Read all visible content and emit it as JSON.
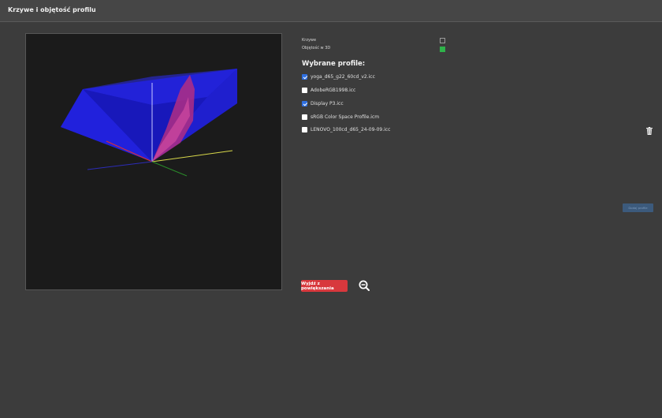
{
  "window": {
    "title": "Krzywe i objętość profilu"
  },
  "options": [
    {
      "label": "Krzywe",
      "checked": false
    },
    {
      "label": "Objętość w 3D",
      "checked": true
    }
  ],
  "profiles": {
    "heading": "Wybrane profile:",
    "items": [
      {
        "label": "yoga_d65_g22_60cd_v2.icc",
        "checked": true
      },
      {
        "label": "AdobeRGB1998.icc",
        "checked": false
      },
      {
        "label": "Display P3.icc",
        "checked": true
      },
      {
        "label": "sRGB Color Space Profile.icm",
        "checked": false
      },
      {
        "label": "LENOVO_100cd_d65_24-09-09.icc",
        "checked": false
      }
    ]
  },
  "buttons": {
    "add_profile": "Dodaj profile",
    "exit_zoom": "Wyjdź z powiększania"
  },
  "icons": {
    "delete": "trash-icon",
    "zoom_out": "zoom-out-icon"
  },
  "colors": {
    "volume_blue": "#1a1ad9",
    "volume_pink": "#c0307a",
    "axis_x": "#d92a2a",
    "axis_y": "#d8d84a",
    "axis_z": "#2a8a2a",
    "axis_vertical": "#b8b8ff",
    "accent_green": "#2fb34a",
    "danger_red": "#d8383d",
    "checkbox_blue": "#2f6fe0"
  }
}
